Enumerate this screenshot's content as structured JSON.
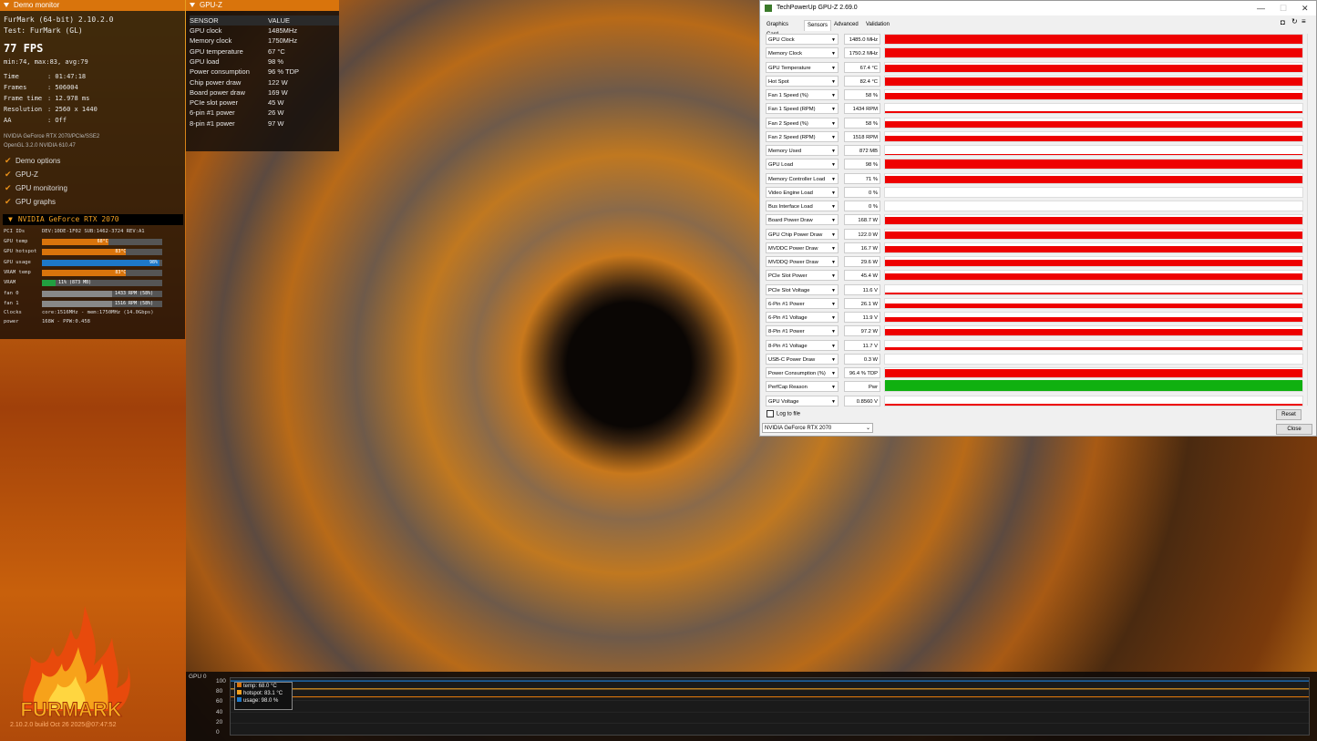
{
  "demo_monitor": {
    "header": "Demo monitor",
    "app_title": "FurMark (64-bit) 2.10.2.0",
    "test": "Test: FurMark (GL)",
    "fps": "77 FPS",
    "fps_stats": "min:74, max:83, avg:79",
    "stats": [
      {
        "label": "Time",
        "value": ": 01:47:18"
      },
      {
        "label": "Frames",
        "value": ": 506004"
      },
      {
        "label": "Frame time",
        "value": ": 12.978 ms"
      },
      {
        "label": "Resolution",
        "value": ": 2560 x 1440"
      },
      {
        "label": "AA",
        "value": ": Off"
      }
    ],
    "renderer": "NVIDIA GeForce RTX 2070/PCIe/SSE2",
    "opengl": "OpenGL 3.2.0 NVIDIA 610.47",
    "options": [
      "Demo options",
      "GPU-Z",
      "GPU monitoring",
      "GPU graphs"
    ],
    "gpu_title": "NVIDIA GeForce RTX 2070",
    "pci_label": "PCI IDs",
    "pci_value": "DEV:10DE-1F02 SUB:1462-3724 REV:A1",
    "bars": [
      {
        "label": "GPU temp",
        "text": "68°C",
        "fill": 0.55,
        "color": "#d9740c"
      },
      {
        "label": "GPU hotspot",
        "text": "83°C",
        "fill": 0.7,
        "color": "#d9740c"
      },
      {
        "label": "GPU usage",
        "text": "98%",
        "fill": 0.98,
        "color": "#1e78c8"
      },
      {
        "label": "VRAM temp",
        "text": "83°C",
        "fill": 0.7,
        "color": "#d9740c"
      },
      {
        "label": "VRAM",
        "text": "11% (873 MB)",
        "fill": 0.11,
        "color": "#22a040"
      },
      {
        "label": "fan 0",
        "text": "1433 RPM (58%)",
        "fill": 0.58,
        "color": "#888888"
      },
      {
        "label": "fan 1",
        "text": "1516 RPM (58%)",
        "fill": 0.58,
        "color": "#888888"
      }
    ],
    "clocks_label": "Clocks",
    "clocks_value": "core:1516MHz - mem:1750MHz (14.0Gbps)",
    "power_label": "power",
    "power_value": "168W - PPW:0.458",
    "version": "2.10.2.0 build Oct 26 2025@07:47:52",
    "logo_text": "FURMARK"
  },
  "gpuz_overlay": {
    "header": "GPU-Z",
    "col_sensor": "SENSOR",
    "col_value": "VALUE",
    "rows": [
      {
        "s": "GPU clock",
        "v": "1485MHz"
      },
      {
        "s": "Memory clock",
        "v": "1750MHz"
      },
      {
        "s": "GPU temperature",
        "v": "67 °C"
      },
      {
        "s": "GPU load",
        "v": "98 %"
      },
      {
        "s": "Power consumption",
        "v": "96 % TDP"
      },
      {
        "s": "Chip power draw",
        "v": "122 W"
      },
      {
        "s": "Board power draw",
        "v": "169 W"
      },
      {
        "s": "PCIe slot power",
        "v": "45 W"
      },
      {
        "s": "6-pin #1 power",
        "v": "26 W"
      },
      {
        "s": "8-pin #1 power",
        "v": "97 W"
      }
    ]
  },
  "gpuz_window": {
    "title": "TechPowerUp GPU-Z 2.69.0",
    "tabs": [
      "Graphics Card",
      "Sensors",
      "Advanced",
      "Validation"
    ],
    "active_tab": "Sensors",
    "sensors": [
      {
        "name": "GPU Clock",
        "value": "1485.0 MHz",
        "level": 0.85,
        "color": "#ee0000"
      },
      {
        "name": "Memory Clock",
        "value": "1750.2 MHz",
        "level": 0.85,
        "color": "#ee0000"
      },
      {
        "name": "GPU Temperature",
        "value": "67.4 °C",
        "level": 0.7,
        "color": "#ee0000"
      },
      {
        "name": "Hot Spot",
        "value": "82.4 °C",
        "level": 0.75,
        "color": "#ee0000"
      },
      {
        "name": "Fan 1 Speed (%)",
        "value": "58 %",
        "level": 0.6,
        "color": "#ee0000"
      },
      {
        "name": "Fan 1 Speed (RPM)",
        "value": "1434 RPM",
        "level": 0.15,
        "color": "#ee0000"
      },
      {
        "name": "Fan 2 Speed (%)",
        "value": "58 %",
        "level": 0.6,
        "color": "#ee0000"
      },
      {
        "name": "Fan 2 Speed (RPM)",
        "value": "1518 RPM",
        "level": 0.5,
        "color": "#ee0000"
      },
      {
        "name": "Memory Used",
        "value": "872 MB",
        "level": 0.06,
        "color": "#ee0000"
      },
      {
        "name": "GPU Load",
        "value": "98 %",
        "level": 0.85,
        "color": "#ee0000"
      },
      {
        "name": "Memory Controller Load",
        "value": "71 %",
        "level": 0.65,
        "color": "#ee0000"
      },
      {
        "name": "Video Engine Load",
        "value": "0 %",
        "level": 0.0,
        "color": "#ee0000"
      },
      {
        "name": "Bus Interface Load",
        "value": "0 %",
        "level": 0.0,
        "color": "#ee0000"
      },
      {
        "name": "Board Power Draw",
        "value": "168.7 W",
        "level": 0.7,
        "color": "#ee0000"
      },
      {
        "name": "GPU Chip Power Draw",
        "value": "122.0 W",
        "level": 0.7,
        "color": "#ee0000"
      },
      {
        "name": "MVDDC Power Draw",
        "value": "16.7 W",
        "level": 0.55,
        "color": "#ee0000"
      },
      {
        "name": "MVDDQ Power Draw",
        "value": "29.6 W",
        "level": 0.6,
        "color": "#ee0000"
      },
      {
        "name": "PCIe Slot Power",
        "value": "45.4 W",
        "level": 0.55,
        "color": "#ee0000"
      },
      {
        "name": "PCIe Slot Voltage",
        "value": "11.6 V",
        "level": 0.2,
        "color": "#ee0000"
      },
      {
        "name": "6-Pin #1 Power",
        "value": "26.1 W",
        "level": 0.45,
        "color": "#ee0000"
      },
      {
        "name": "6-Pin #1 Voltage",
        "value": "11.9 V",
        "level": 0.4,
        "color": "#ee0000"
      },
      {
        "name": "8-Pin #1 Power",
        "value": "97.2 W",
        "level": 0.6,
        "color": "#ee0000"
      },
      {
        "name": "8-Pin #1 Voltage",
        "value": "11.7 V",
        "level": 0.25,
        "color": "#ee0000"
      },
      {
        "name": "USB-C Power Draw",
        "value": "0.3 W",
        "level": 0.0,
        "color": "#ee0000"
      },
      {
        "name": "Power Consumption (%)",
        "value": "96.4 % TDP",
        "level": 0.75,
        "color": "#ee0000"
      },
      {
        "name": "PerfCap Reason",
        "value": "Pwr",
        "level": 1.0,
        "color": "#10b010"
      },
      {
        "name": "GPU Voltage",
        "value": "0.8560 V",
        "level": 0.2,
        "color": "#ee0000"
      }
    ],
    "log_to_file": "Log to file",
    "reset": "Reset",
    "close": "Close",
    "device": "NVIDIA GeForce RTX 2070"
  },
  "graph_panel": {
    "title": "GPU 0",
    "y_ticks": [
      "100",
      "80",
      "60",
      "40",
      "20",
      "0"
    ],
    "legend": [
      {
        "label": "temp: 68.0 °C",
        "color": "#d9740c",
        "value": 68
      },
      {
        "label": "hotspot: 83.1 °C",
        "color": "#f0a020",
        "value": 83.1
      },
      {
        "label": "usage: 98.0 %",
        "color": "#1e78c8",
        "value": 98
      }
    ]
  }
}
